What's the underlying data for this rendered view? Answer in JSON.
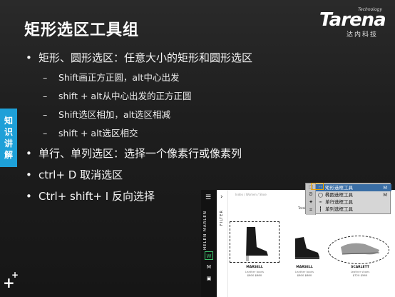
{
  "slide": {
    "title": "矩形选区工具组",
    "side_tab": [
      "知",
      "识",
      "讲",
      "解"
    ],
    "logo": {
      "word": "Tarena",
      "tagline": "Technology",
      "sub": "达内科技"
    },
    "bullets": [
      {
        "level": 1,
        "text": "矩形、圆形选区：任意大小的矩形和圆形选区"
      },
      {
        "level": 2,
        "text": "Shift画正方正圆，alt中心出发"
      },
      {
        "level": 2,
        "text": "shift + alt从中心出发的正方正圆"
      },
      {
        "level": 2,
        "text": "Shift选区相加，alt选区相减"
      },
      {
        "level": 2,
        "text": "shift + alt选区相交"
      },
      {
        "level": 1,
        "text": "单行、单列选区：选择一个像素行或像素列"
      },
      {
        "level": 1,
        "text": "ctrl+ D  取消选区"
      },
      {
        "level": 1,
        "text": "Ctrl+ shift+ I 反向选择"
      }
    ],
    "bullet_dot": "•",
    "bullet_dash": "–"
  },
  "web_shot": {
    "brand": "HELEN MARLEN",
    "filter": "FILTER",
    "breadcrumb": "Index / Women / Shoe",
    "total": "Total 897",
    "nav_icons": [
      "hamburger-icon",
      "w-icon",
      "m-icon",
      "bag-icon"
    ],
    "nav_labels": {
      "w": "W",
      "m": "M"
    },
    "products": [
      {
        "name": "MARSELL",
        "sub": "Leather boots",
        "price": "$800 $680"
      },
      {
        "name": "MARSELL",
        "sub": "Leather boots",
        "price": "$800 $680"
      },
      {
        "name": "SCARLETT",
        "sub": "Leather shoes",
        "price": "$720 $560"
      }
    ]
  },
  "tool_menu": {
    "items": [
      {
        "icon": "rect-marquee-icon",
        "label": "矩形选框工具",
        "key": "M",
        "selected": true
      },
      {
        "icon": "ellipse-marquee-icon",
        "label": "椭圆选框工具",
        "key": "M",
        "selected": false
      },
      {
        "icon": "single-row-marquee-icon",
        "label": "单行选框工具",
        "key": "",
        "selected": false
      },
      {
        "icon": "single-column-marquee-icon",
        "label": "单列选框工具",
        "key": "",
        "selected": false
      }
    ]
  },
  "colors": {
    "accent": "#1ea0d8",
    "background": "#1b1b1b",
    "selected_tool": "#3a6ea5"
  }
}
